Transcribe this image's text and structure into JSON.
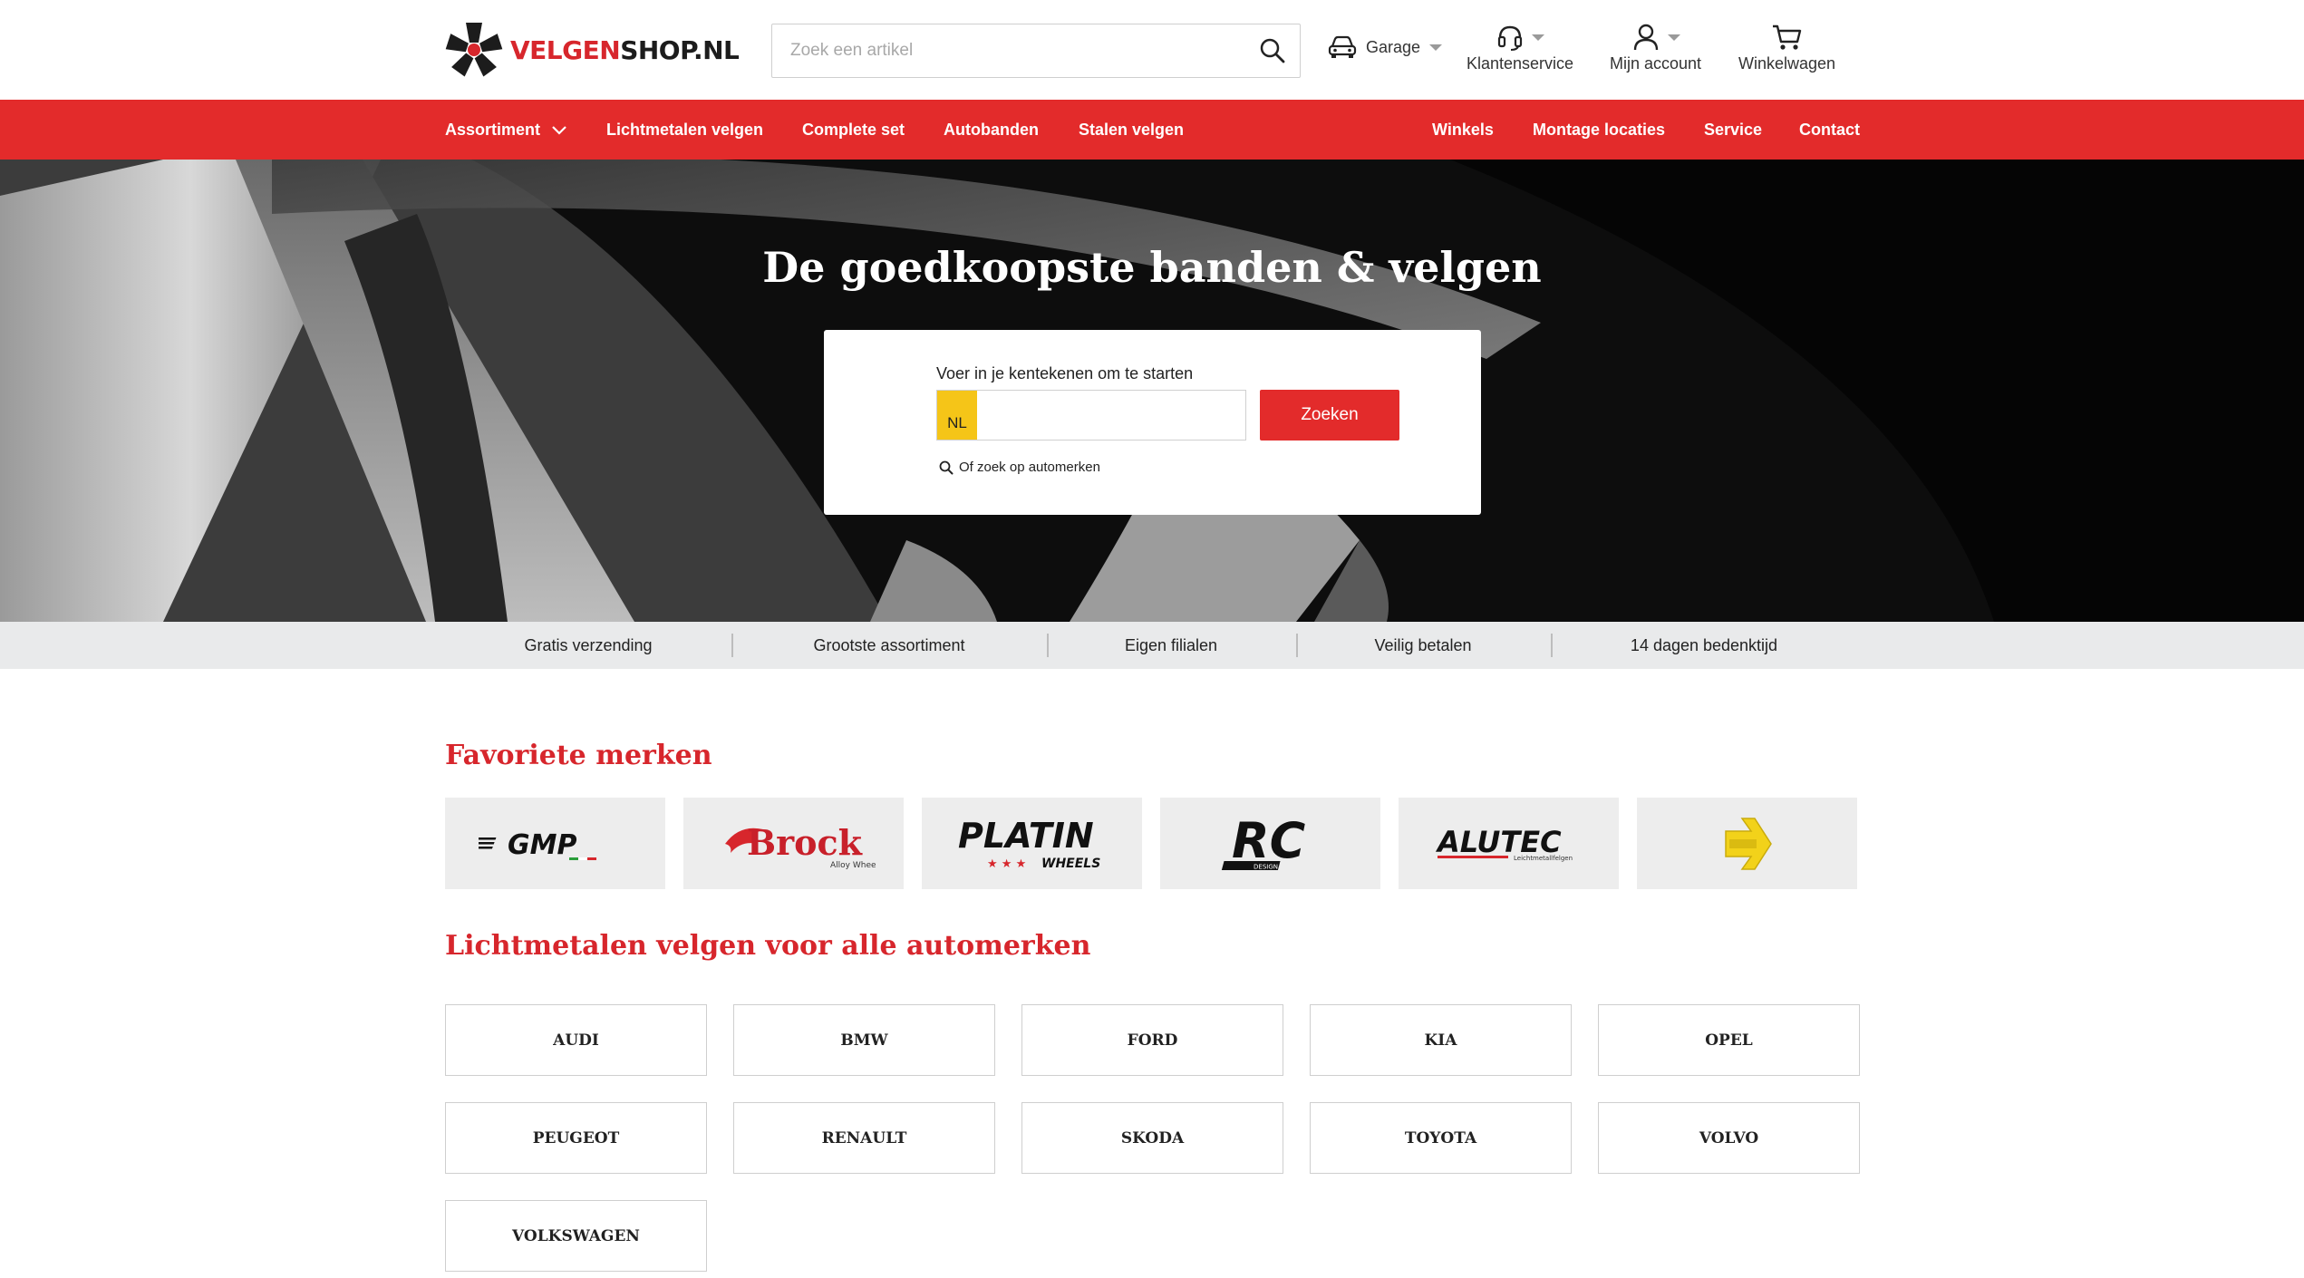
{
  "header": {
    "logo": {
      "part1": "VELGEN",
      "part2": "SHOP.NL"
    },
    "search": {
      "placeholder": "Zoek een artikel"
    },
    "garage_label": "Garage",
    "customer_service_label": "Klantenservice",
    "account_label": "Mijn account",
    "cart_label": "Winkelwagen"
  },
  "nav": {
    "left": [
      "Assortiment",
      "Lichtmetalen velgen",
      "Complete set",
      "Autobanden",
      "Stalen velgen"
    ],
    "right": [
      "Winkels",
      "Montage locaties",
      "Service",
      "Contact"
    ]
  },
  "hero": {
    "title": "De goedkoopste banden & velgen",
    "plate_label": "Voer in je kentekenen om te starten",
    "plate_prefix": "NL",
    "plate_value": "",
    "search_button": "Zoeken",
    "alt_link": "Of zoek op automerken"
  },
  "usps": [
    "Gratis verzending",
    "Grootste assortiment",
    "Eigen filialen",
    "Veilig betalen",
    "14 dagen bedenktijd"
  ],
  "brands": {
    "title": "Favoriete merken",
    "items": [
      {
        "name": "GMP",
        "logo_text": "GMP"
      },
      {
        "name": "Brock",
        "logo_text": "Brock",
        "sub": "Alloy Wheels"
      },
      {
        "name": "Platin",
        "logo_text": "PLATIN",
        "sub": "WHEELS"
      },
      {
        "name": "RC Design",
        "logo_text": "RC",
        "sub": "DESIGN"
      },
      {
        "name": "Alutec",
        "logo_text": "ALUTEC",
        "sub": "Leichtmetallfelgen"
      },
      {
        "name": "Dezent",
        "logo_text": ""
      }
    ]
  },
  "makes": {
    "title": "Lichtmetalen velgen voor alle automerken",
    "items": [
      "AUDI",
      "BMW",
      "FORD",
      "KIA",
      "OPEL",
      "PEUGEOT",
      "RENAULT",
      "SKODA",
      "TOYOTA",
      "VOLVO",
      "VOLKSWAGEN"
    ]
  },
  "colors": {
    "brand_red": "#e32b2b",
    "title_red": "#d7262c",
    "plate_yellow": "#f5c518",
    "usp_bg": "#e9eaeb"
  }
}
